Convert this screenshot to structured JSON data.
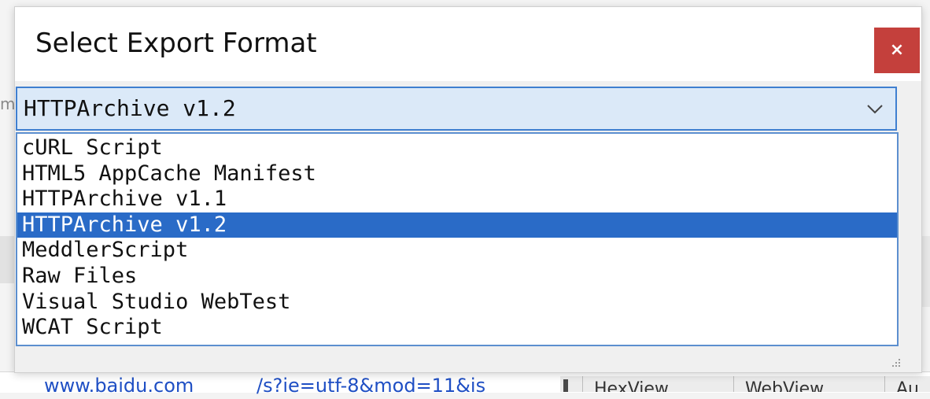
{
  "background": {
    "left_fragment": "m",
    "url_host": "www.baidu.com",
    "url_path": "/s?ie=utf-8&mod=11&is",
    "tabs": [
      "HexView",
      "WebView",
      "Au"
    ]
  },
  "dialog": {
    "title": "Select Export Format",
    "close_label": "×"
  },
  "format_select": {
    "selected_value": "HTTPArchive v1.2",
    "options": [
      "cURL Script",
      "HTML5 AppCache Manifest",
      "HTTPArchive v1.1",
      "HTTPArchive v1.2",
      "MeddlerScript",
      "Raw Files",
      "Visual Studio WebTest",
      "WCAT Script"
    ],
    "highlighted_index": 3
  },
  "colors": {
    "close_button": "#c4403c",
    "selection_highlight": "#2a6bc7",
    "select_background": "#dbe9f8",
    "select_border": "#3f7fd0",
    "link_text": "#1f4fc4"
  }
}
